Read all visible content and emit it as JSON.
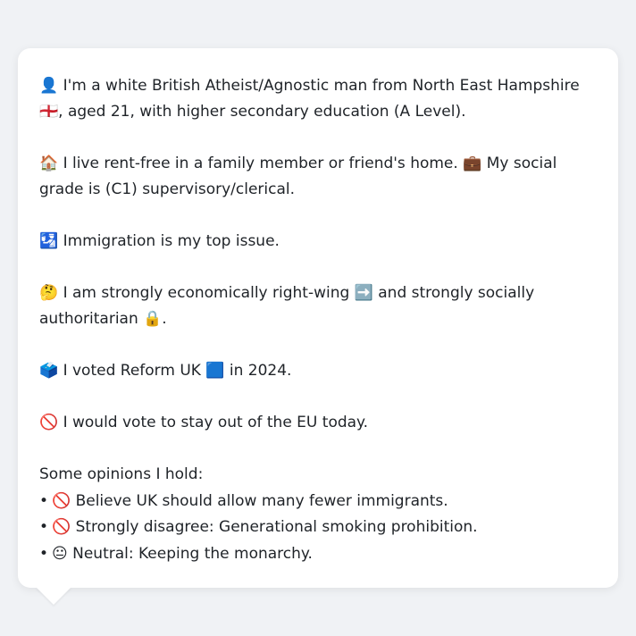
{
  "profile": {
    "line1": "👤 I'm a white British Atheist/Agnostic man from North East Hampshire 🏴󠁧󠁢󠁥󠁮󠁧󠁿, aged 21, with higher secondary education (A Level).",
    "line2": "🏠 I live rent-free in a family member or friend's home. 💼 My social grade is (C1) supervisory/clerical.",
    "line3": "🛂 Immigration is my top issue.",
    "line4": "🤔 I am strongly economically right-wing ➡️ and strongly socially authoritarian 🔒.",
    "line5": "🗳️ I voted Reform UK 🟦 in 2024.",
    "line6": "🚫 I would vote to stay out of the EU today."
  },
  "opinions": {
    "heading": "Some opinions I hold:",
    "bullet": "•",
    "items": [
      "🚫 Believe UK should allow many fewer immigrants.",
      "🚫 Strongly disagree: Generational smoking prohibition.",
      "😐 Neutral: Keeping the monarchy."
    ]
  }
}
